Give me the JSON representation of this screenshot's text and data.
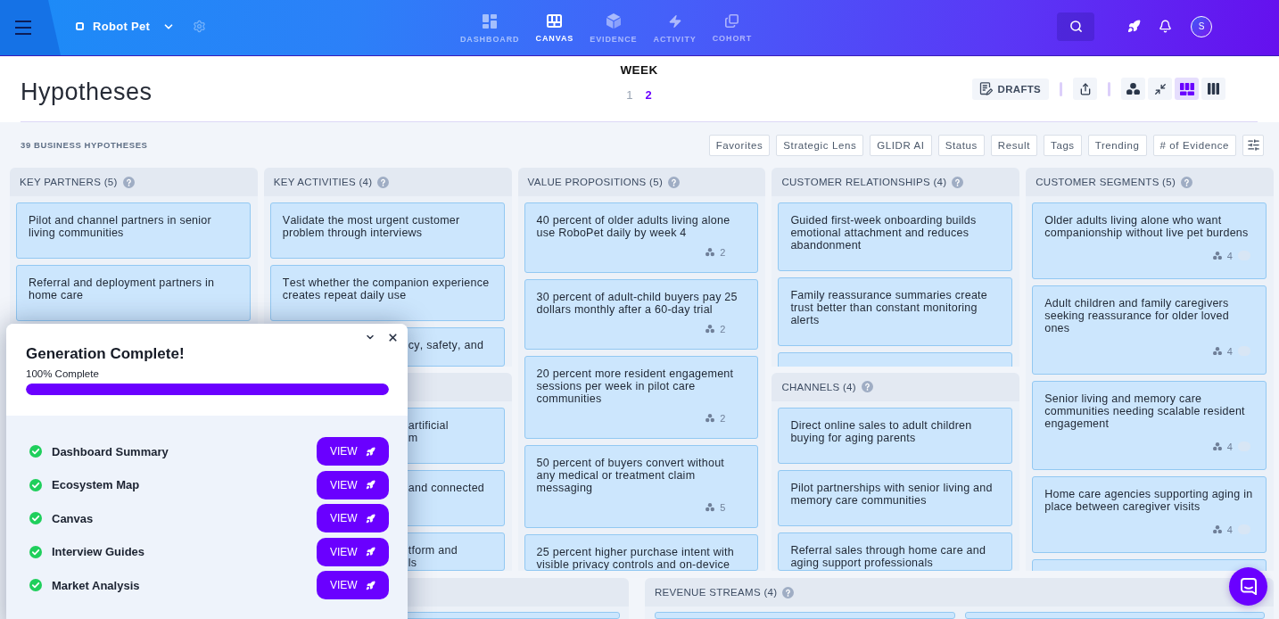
{
  "top_bar": {
    "project": "Robot Pet",
    "nav": [
      {
        "kind": "dashboard",
        "label": "DASHBOARD",
        "selected": false
      },
      {
        "kind": "canvas",
        "label": "CANVAS",
        "selected": true
      },
      {
        "kind": "evidence",
        "label": "EVIDENCE",
        "selected": false
      },
      {
        "kind": "activity",
        "label": "ACTIVITY",
        "selected": false
      },
      {
        "kind": "cohort",
        "label": "COHORT",
        "selected": false
      }
    ],
    "avatar": "S"
  },
  "header": {
    "title": "Hypotheses",
    "week": {
      "label": "WEEK",
      "options": [
        {
          "label": "1",
          "selected": false
        },
        {
          "label": "2",
          "selected": true
        }
      ]
    },
    "drafts": "DRAFTS",
    "views": [
      {
        "kind": "cluster",
        "selected": false
      },
      {
        "kind": "collapse",
        "selected": false
      },
      {
        "kind": "grid",
        "selected": true
      },
      {
        "kind": "columns",
        "selected": false
      }
    ]
  },
  "summary": "39 BUSINESS HYPOTHESES",
  "filters": [
    "Favorites",
    "Strategic Lens",
    "GLIDR AI",
    "Status",
    "Result",
    "Tags",
    "Trending",
    "# of Evidence"
  ],
  "canvas": {
    "columns": [
      {
        "sections": [
          {
            "title": "KEY PARTNERS (5)",
            "cards": [
              {
                "text": "Pilot and channel partners in senior living communities"
              },
              {
                "text": "Referral and deployment partners in home care"
              }
            ]
          }
        ]
      },
      {
        "sections": [
          {
            "title": "KEY ACTIVITIES (4)",
            "cards": [
              {
                "text": "Validate the most urgent customer problem through interviews",
                "covered": false
              },
              {
                "text": "Test whether the companion experience creates repeat daily use",
                "covered": false
              },
              {
                "text": "cy, safety, and",
                "covered": true
              }
            ]
          },
          {
            "cards": [
              {
                "text": "artificial\nm",
                "covered": true
              },
              {
                "text": "and connected",
                "covered": true
              },
              {
                "text": "tform and\nls",
                "covered": true
              }
            ]
          }
        ]
      },
      {
        "sections": [
          {
            "title": "VALUE PROPOSITIONS (5)",
            "cards": [
              {
                "text": "40 percent of older adults living alone use RoboPet daily by week 4",
                "count": "2"
              },
              {
                "text": "30 percent of adult-child buyers pay 25 dollars monthly after a 60-day trial",
                "count": "2"
              },
              {
                "text": "20 percent more resident engagement sessions per week in pilot care communities",
                "count": "2"
              },
              {
                "text": "50 percent of buyers convert without any medical or treatment claim messaging",
                "count": "5"
              },
              {
                "text": "25 percent higher purchase intent with visible privacy controls and on-device"
              }
            ]
          }
        ]
      },
      {
        "sections": [
          {
            "title": "CUSTOMER RELATIONSHIPS (4)",
            "cards": [
              {
                "kind": "text",
                "text": "Guided first-week onboarding builds emotional attachment and reduces abandonment"
              },
              {
                "kind": "text",
                "text": "Family reassurance summaries create trust better than constant monitoring alerts"
              },
              {
                "kind": "stub"
              }
            ]
          },
          {
            "title": "CHANNELS (4)",
            "cards": [
              {
                "text": "Direct online sales to adult children buying for aging parents"
              },
              {
                "text": "Pilot partnerships with senior living and memory care communities"
              },
              {
                "text": "Referral sales through home care and aging support professionals"
              }
            ]
          }
        ]
      },
      {
        "sections": [
          {
            "title": "CUSTOMER SEGMENTS (5)",
            "cards": [
              {
                "kind": "text",
                "text": "Older adults living alone who want companionship without live pet burdens",
                "count": "4",
                "pill": true
              },
              {
                "kind": "text",
                "text": "Adult children and family caregivers seeking reassurance for older loved ones",
                "count": "4",
                "pill": true
              },
              {
                "kind": "text",
                "text": "Senior living and memory care communities needing scalable resident engagement",
                "count": "4",
                "pill": true
              },
              {
                "kind": "text",
                "text": "Home care agencies supporting aging in place between caregiver visits",
                "count": "4",
                "pill": true
              },
              {
                "kind": "stub"
              }
            ]
          }
        ]
      }
    ],
    "bottom_sections": [
      {
        "cards": [
          {
            "kind": "stub"
          }
        ]
      },
      {
        "title": "REVENUE STREAMS (4)",
        "cards": [
          {
            "kind": "stub"
          },
          {
            "kind": "stub"
          }
        ]
      }
    ]
  },
  "popup": {
    "title": "Generation Complete!",
    "progress_label": "100% Complete",
    "level": 1,
    "items": [
      {
        "label": "Dashboard Summary",
        "complete": true,
        "action": "VIEW"
      },
      {
        "label": "Ecosystem Map",
        "complete": true,
        "action": "VIEW"
      },
      {
        "label": "Canvas",
        "complete": true,
        "action": "VIEW"
      },
      {
        "label": "Interview Guides",
        "complete": true,
        "action": "VIEW"
      },
      {
        "label": "Market Analysis",
        "complete": true,
        "action": "VIEW"
      }
    ]
  }
}
